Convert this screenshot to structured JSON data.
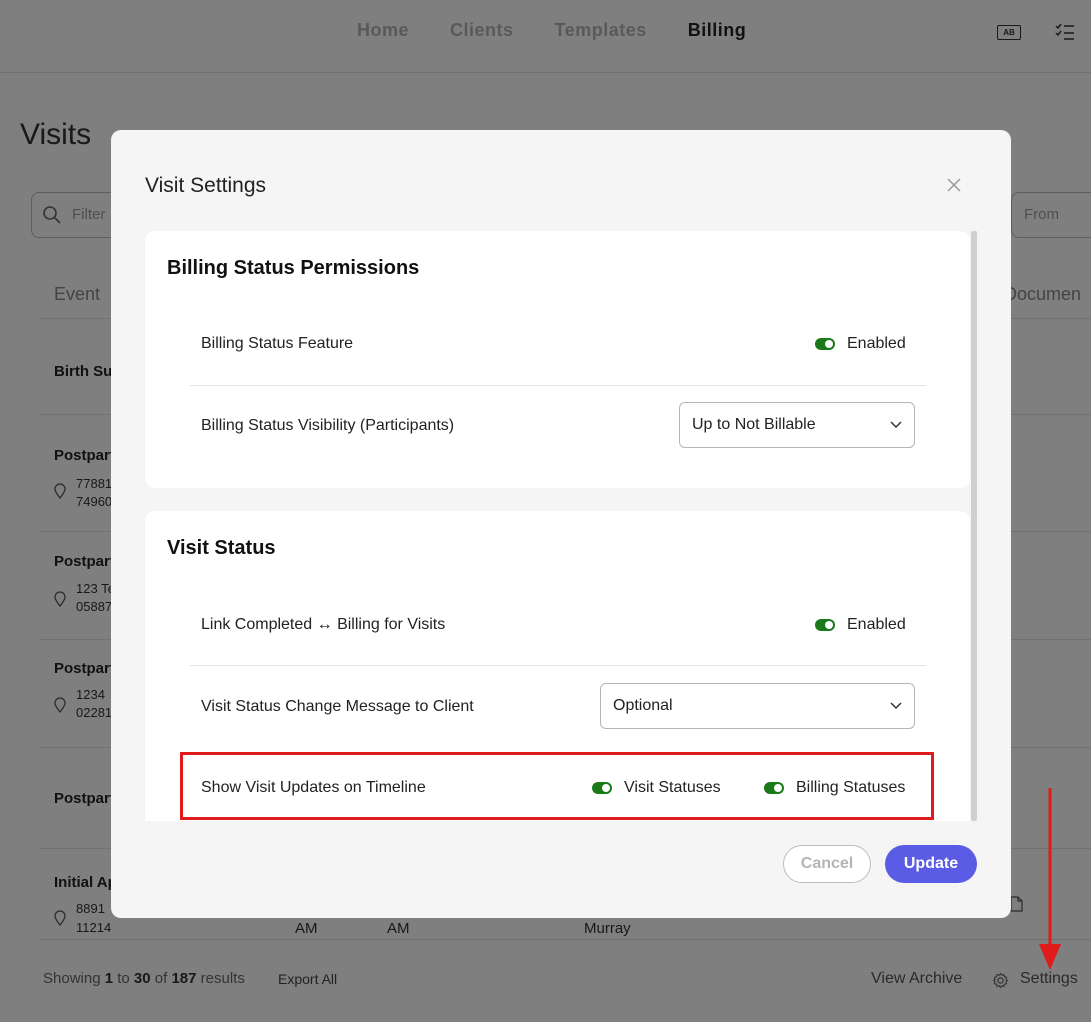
{
  "nav": {
    "items": [
      {
        "label": "Home",
        "active": false
      },
      {
        "label": "Clients",
        "active": false
      },
      {
        "label": "Templates",
        "active": false
      },
      {
        "label": "Billing",
        "active": true
      }
    ],
    "ab_icon_text": "AB"
  },
  "page": {
    "title": "Visits",
    "filter_placeholder": "Filter",
    "from_placeholder": "From",
    "columns": {
      "event": "Event",
      "documents": "Documen"
    },
    "rows": [
      {
        "event": "Birth Su",
        "addr1": "",
        "addr2": ""
      },
      {
        "event": "Postpart",
        "addr1": "77881",
        "addr2": "74960"
      },
      {
        "event": "Postpart",
        "addr1": "123 Te",
        "addr2": "05887"
      },
      {
        "event": "Postpart",
        "addr1": "1234",
        "addr2": "02281"
      },
      {
        "event": "Postpart",
        "addr1": "",
        "addr2": ""
      },
      {
        "event": "Initial Ap",
        "addr1": "8891",
        "addr2": "11214"
      }
    ],
    "bottom_cells": {
      "start": "AM",
      "end": "AM",
      "provider": "Murray"
    },
    "footer": {
      "showing_prefix": "Showing",
      "from": "1",
      "to_word": "to",
      "to": "30",
      "of_word": "of",
      "total": "187",
      "results_word": "results",
      "export_all": "Export All",
      "view_archive": "View Archive",
      "settings": "Settings"
    }
  },
  "modal": {
    "title": "Visit Settings",
    "sections": {
      "billing": {
        "heading": "Billing Status Permissions",
        "feature_label": "Billing Status Feature",
        "feature_toggle_label": "Enabled",
        "visibility_label": "Billing Status Visibility (Participants)",
        "visibility_value": "Up to Not Billable"
      },
      "visit": {
        "heading": "Visit Status",
        "link_label": "Link Completed ↔ Billing for Visits",
        "link_toggle_label": "Enabled",
        "message_label": "Visit Status Change Message to Client",
        "message_value": "Optional",
        "timeline_label": "Show Visit Updates on Timeline",
        "timeline_visit_toggle": "Visit Statuses",
        "timeline_billing_toggle": "Billing Statuses"
      }
    },
    "cancel_label": "Cancel",
    "update_label": "Update"
  },
  "colors": {
    "accent": "#5b5ce6",
    "toggle_on": "#1a7a1a",
    "highlight": "#e01b1b"
  }
}
